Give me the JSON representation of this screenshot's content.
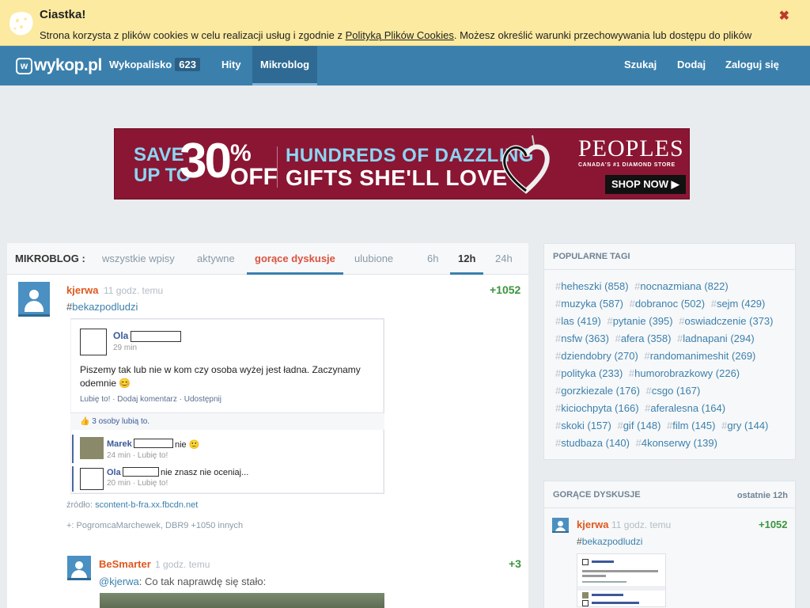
{
  "cookie": {
    "title": "Ciastka!",
    "text_before": "Strona korzysta z plików cookies w celu realizacji usług i zgodnie z ",
    "link": "Polityką Plików Cookies",
    "text_after": ". Możesz określić warunki przechowywania lub dostępu do plików",
    "close_icon": "close-icon",
    "close_symbol": "✖"
  },
  "nav": {
    "logo_text": "wykop.pl",
    "logo_mark": "w",
    "items": [
      {
        "label": "Wykopalisko",
        "badge": "623"
      },
      {
        "label": "Hity"
      },
      {
        "label": "Mikroblog"
      }
    ],
    "right": [
      "Szukaj",
      "Dodaj",
      "Zaloguj się"
    ]
  },
  "ad": {
    "save": "SAVE",
    "up_to": "UP TO",
    "pct": "30",
    "pct_sign": "%",
    "off": "OFF",
    "headline1": "HUNDREDS OF DAZZLING",
    "headline2": "GIFTS SHE'LL LOVE",
    "brand": "PEOPLES",
    "tagline": "CANADA'S #1 DIAMOND STORE",
    "cta": "SHOP NOW ▶",
    "colors": {
      "bg": "#8a1633",
      "accent": "#8bd6f4"
    }
  },
  "tabs": {
    "label": "MIKROBLOG :",
    "items": [
      "wszystkie wpisy",
      "aktywne",
      "gorące dyskusje",
      "ulubione"
    ],
    "times": [
      "6h",
      "12h",
      "24h"
    ]
  },
  "post1": {
    "user": "kjerwa",
    "time": "11 godz. temu",
    "votes": "+1052",
    "hash": "#",
    "tag": "bekazpodludzi",
    "fb": {
      "name": "Ola",
      "time": "29 min",
      "message": "Piszemy tak lub nie w kom czy osoba wyżej jest ładna. Zaczynamy odemnie 😊",
      "actions": "Lubię to! · Dodaj komentarz · Udostępnij",
      "likes": "👍 3 osoby lubią to.",
      "c1_name": "Marek",
      "c1_text": "nie 🙂",
      "c1_sub": "24 min · Lubię to!",
      "c2_name": "Ola",
      "c2_text": "nie znasz nie oceniaj...",
      "c2_sub": "20 min · Lubię to!"
    },
    "source_label": "źródło: ",
    "source_value": "scontent-b-fra.xx.fbcdn.net",
    "plus_label": "+: ",
    "plus_value": "PogromcaMarchewek, DBR9 +1050 innych"
  },
  "post2": {
    "user": "BeSmarter",
    "time": "1 godz. temu",
    "votes": "+3",
    "mention": "@kjerwa",
    "text": ": Co tak naprawdę się stało:"
  },
  "sidebar": {
    "popular_title": "POPULARNE TAGI",
    "tags": [
      {
        "name": "heheszki",
        "count": "(858)"
      },
      {
        "name": "nocnazmiana",
        "count": "(822)"
      },
      {
        "name": "muzyka",
        "count": "(587)"
      },
      {
        "name": "dobranoc",
        "count": "(502)"
      },
      {
        "name": "sejm",
        "count": "(429)"
      },
      {
        "name": "las",
        "count": "(419)"
      },
      {
        "name": "pytanie",
        "count": "(395)"
      },
      {
        "name": "oswiadczenie",
        "count": "(373)"
      },
      {
        "name": "nsfw",
        "count": "(363)"
      },
      {
        "name": "afera",
        "count": "(358)"
      },
      {
        "name": "ladnapani",
        "count": "(294)"
      },
      {
        "name": "dziendobry",
        "count": "(270)"
      },
      {
        "name": "randomanimeshit",
        "count": "(269)"
      },
      {
        "name": "polityka",
        "count": "(233)"
      },
      {
        "name": "humorobrazkowy",
        "count": "(226)"
      },
      {
        "name": "gorzkiezale",
        "count": "(176)"
      },
      {
        "name": "csgo",
        "count": "(167)"
      },
      {
        "name": "kiciochpyta",
        "count": "(166)"
      },
      {
        "name": "aferalesna",
        "count": "(164)"
      },
      {
        "name": "skoki",
        "count": "(157)"
      },
      {
        "name": "gif",
        "count": "(148)"
      },
      {
        "name": "film",
        "count": "(145)"
      },
      {
        "name": "gry",
        "count": "(144)"
      },
      {
        "name": "studbaza",
        "count": "(140)"
      },
      {
        "name": "4konserwy",
        "count": "(139)"
      }
    ],
    "hot_title": "GORĄCE DYSKUSJE",
    "hot_range": "ostatnie 12h",
    "hot": {
      "user": "kjerwa",
      "time": "11 godz. temu",
      "votes": "+1052",
      "hash": "#",
      "tag": "bekazpodludzi"
    }
  }
}
